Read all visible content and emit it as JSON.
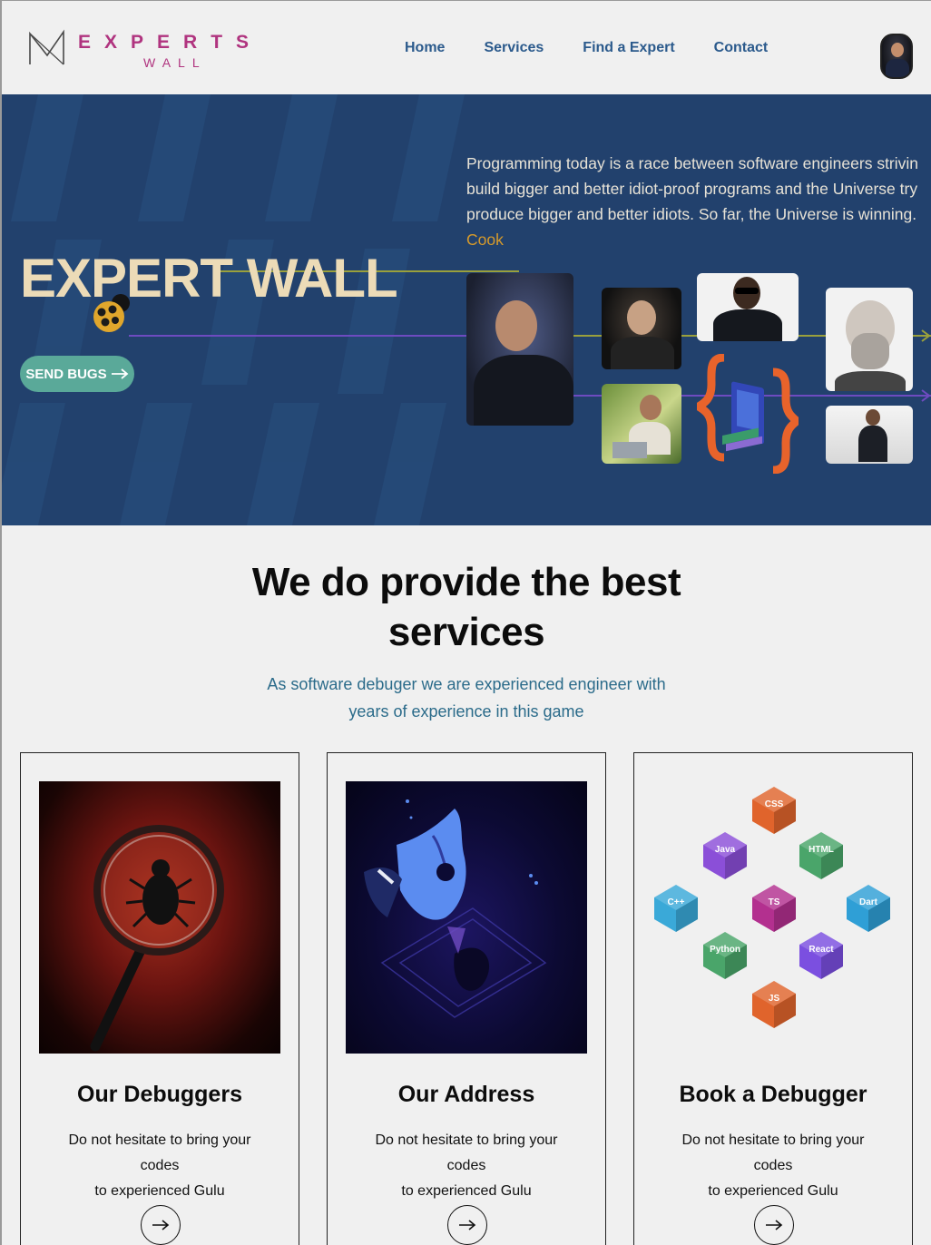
{
  "brand": {
    "name": "EXPERTS",
    "sub": "WALL",
    "color": "#b0347f"
  },
  "nav": [
    {
      "label": "Home"
    },
    {
      "label": "Services"
    },
    {
      "label": "Find a Expert"
    },
    {
      "label": "Contact"
    }
  ],
  "hero": {
    "title": "EXPERT WALL",
    "cta_label": "SEND BUGS",
    "quote_lines": [
      "Programming today is a race between software engineers strivin",
      "build bigger and better idiot-proof programs and the Universe try",
      "produce bigger and better idiots. So far, the Universe is winning."
    ],
    "quote_author": "Cook",
    "background": "#22416d",
    "title_color": "#ecdbb7",
    "cta_color": "#5aa999"
  },
  "services": {
    "title_line1": "We do provide the best",
    "title_line2": "services",
    "subtitle_line1": "As software debuger we are experienced engineer with",
    "subtitle_line2": "years of experience in this game",
    "cards": [
      {
        "title": "Our Debuggers",
        "text_line1": "Do not hesitate to bring your codes",
        "text_line2": "to experienced Gulu"
      },
      {
        "title": "Our Address",
        "text_line1": "Do not hesitate to bring your codes",
        "text_line2": "to experienced Gulu"
      },
      {
        "title": "Book a Debugger",
        "text_line1": "Do not hesitate to bring your codes",
        "text_line2": "to experienced Gulu"
      }
    ],
    "tech_cubes": [
      "C++",
      "Java",
      "HTML",
      "TS",
      "JS",
      "CSS",
      "Python",
      "React",
      "Dart"
    ]
  }
}
